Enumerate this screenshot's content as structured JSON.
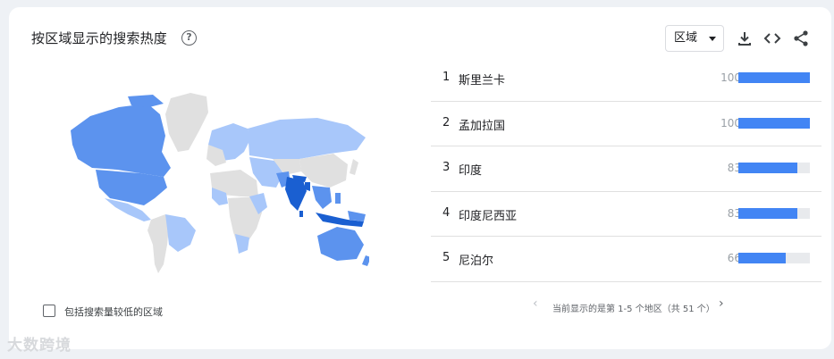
{
  "header": {
    "title": "按区域显示的搜索热度"
  },
  "controls": {
    "dropdown_label": "区域"
  },
  "icons": {
    "help": "help-circle-icon",
    "download": "download-icon",
    "embed": "code-embed-icon",
    "share": "share-icon"
  },
  "colors": {
    "bar": "#4285f4",
    "bar_track": "#e8eaed",
    "map_dark": "#1a5fd1",
    "map_mid": "#5c93ee",
    "map_light": "#a8c7fa",
    "map_none": "#e0e0e0"
  },
  "regions": [
    {
      "rank": "1",
      "name": "斯里兰卡",
      "value": 100
    },
    {
      "rank": "2",
      "name": "孟加拉国",
      "value": 100
    },
    {
      "rank": "3",
      "name": "印度",
      "value": 83
    },
    {
      "rank": "4",
      "name": "印度尼西亚",
      "value": 83
    },
    {
      "rank": "5",
      "name": "尼泊尔",
      "value": 66
    }
  ],
  "footer": {
    "include_low_volume": "包括搜索量较低的区域",
    "pagination": "当前显示的是第 1-5 个地区（共 51 个）"
  },
  "watermark": "大数跨境"
}
